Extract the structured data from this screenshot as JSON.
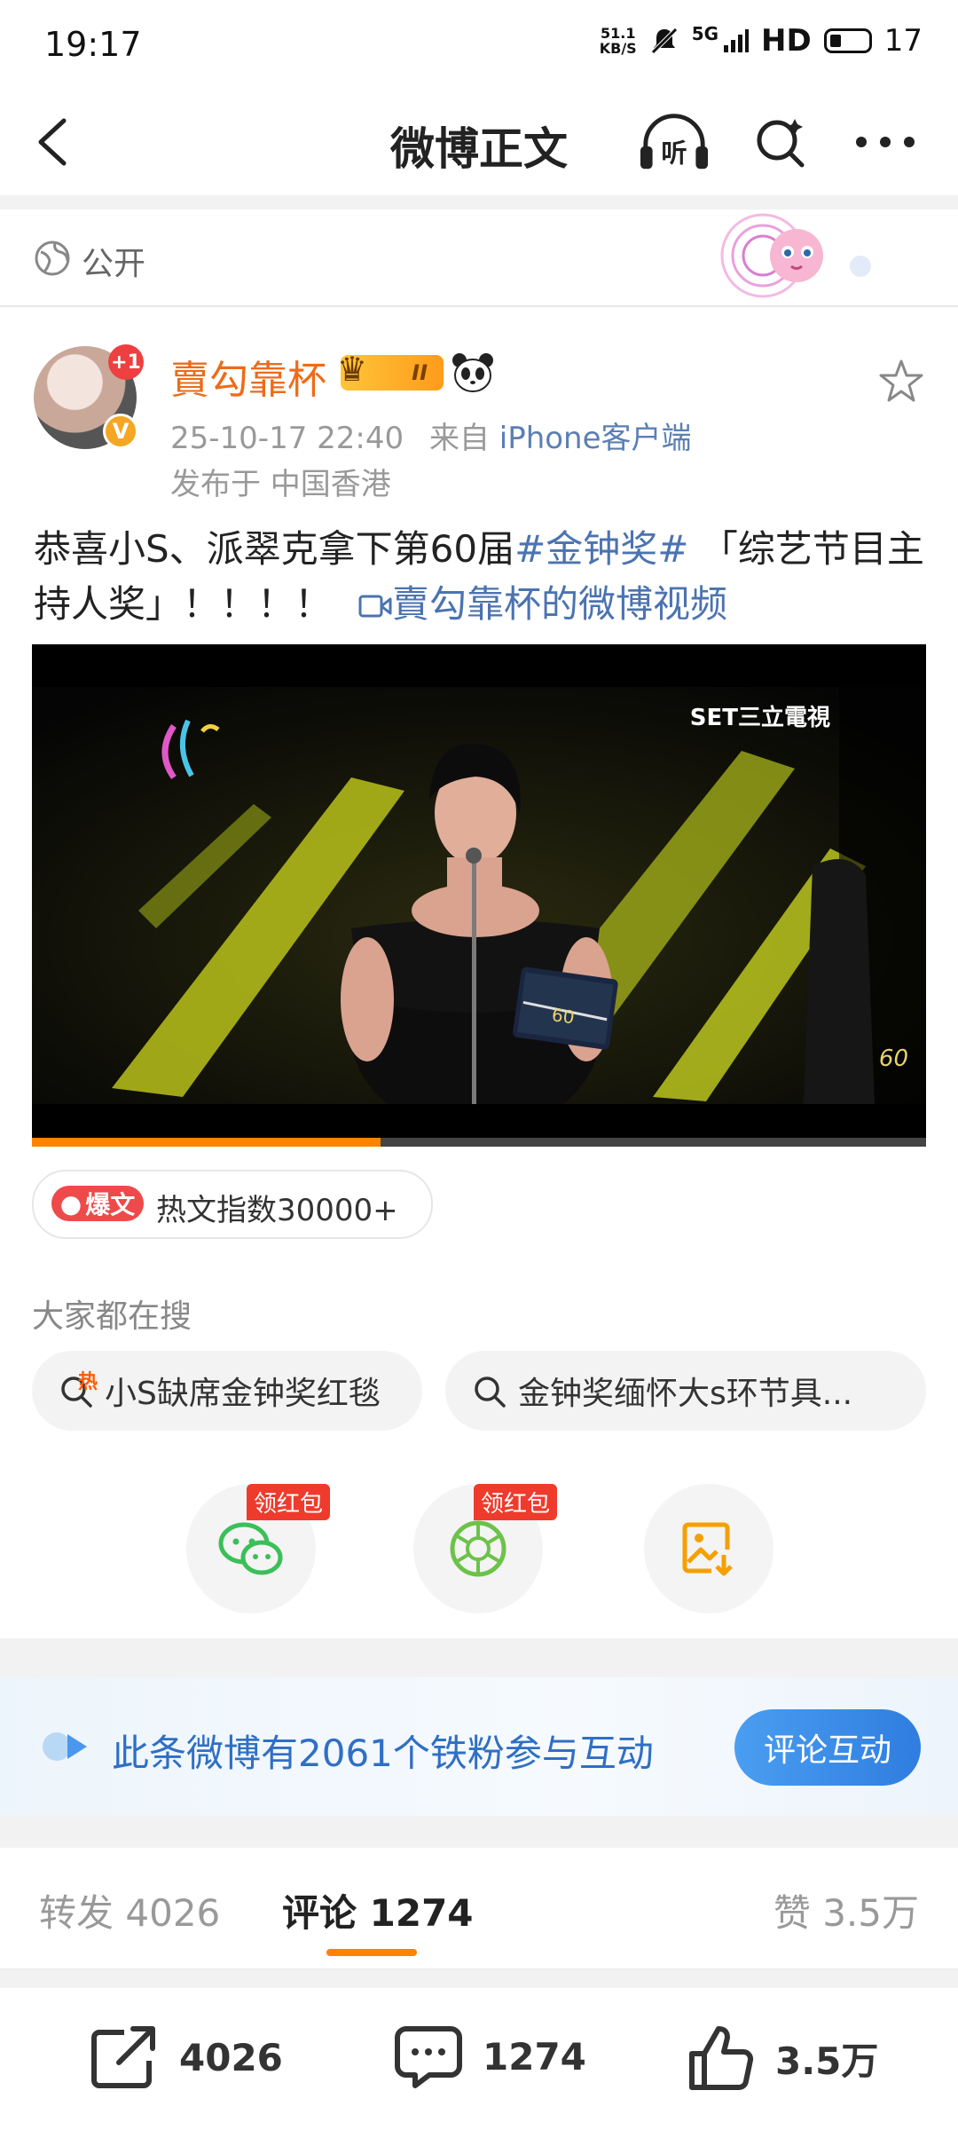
{
  "status_bar": {
    "time": "19:17",
    "speed_value": "51.1",
    "speed_unit": "KB/S",
    "network": "5G",
    "hd": "HD",
    "battery": "17"
  },
  "header": {
    "title": "微博正文",
    "listen_label": "听"
  },
  "visibility": {
    "label": "公开"
  },
  "post": {
    "avatar_badge": "+1",
    "username": "賣勾靠杯",
    "member_level": "II",
    "timestamp": "25-10-17 22:40",
    "from_prefix": "来自",
    "source": "iPhone客户端",
    "location": "发布于 中国香港",
    "text_before": "恭喜小S、派翠克拿下第60届",
    "hashtag": "#金钟奖#",
    "text_after": " 「综艺节目主持人奖」！！！！",
    "video_link": "賣勾靠杯的微博视频",
    "video": {
      "channel_logo": "SET三立電視",
      "watermark": "60",
      "progress": 0.39
    },
    "hot": {
      "badge": "爆文",
      "text": "热文指数30000+"
    }
  },
  "searches": {
    "label": "大家都在搜",
    "items": [
      {
        "text": "小S缺席金钟奖红毯",
        "hot_mark": "热"
      },
      {
        "text": "金钟奖缅怀大s环节具..."
      }
    ]
  },
  "share": {
    "red_packet_label": "领红包",
    "items": [
      "wechat-icon",
      "moments-icon",
      "save-image-icon"
    ]
  },
  "fans_banner": {
    "text": "此条微博有2061个铁粉参与互动",
    "button": "评论互动"
  },
  "tabs": {
    "repost_label": "转发",
    "repost_count": "4026",
    "comment_label": "评论",
    "comment_count": "1274",
    "like_label": "赞",
    "like_count": "3.5万"
  },
  "bottom_bar": {
    "repost": "4026",
    "comment": "1274",
    "like": "3.5万"
  },
  "colors": {
    "accent_orange": "#ff8200",
    "username": "#ee6b17",
    "link_blue": "#4b73b0",
    "banner_blue": "#2f7de0"
  }
}
